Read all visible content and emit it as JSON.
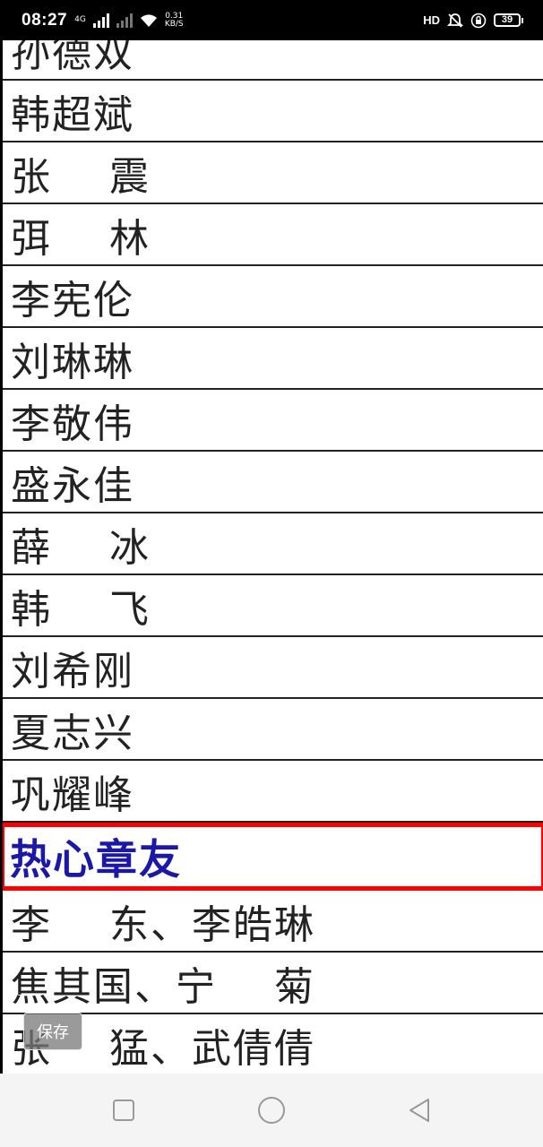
{
  "status_bar": {
    "time": "08:27",
    "network_type": "4G",
    "speed_value": "0.31",
    "speed_unit": "KB/S",
    "hd_label": "HD",
    "battery_level": "39"
  },
  "table": {
    "rows": [
      {
        "text": "孙德双",
        "type": "name"
      },
      {
        "text": "韩超斌",
        "type": "name"
      },
      {
        "text": "张    震",
        "type": "name"
      },
      {
        "text": "弭    林",
        "type": "name"
      },
      {
        "text": "李宪伦",
        "type": "name"
      },
      {
        "text": "刘琳琳",
        "type": "name"
      },
      {
        "text": "李敬伟",
        "type": "name"
      },
      {
        "text": "盛永佳",
        "type": "name"
      },
      {
        "text": "薛    冰",
        "type": "name"
      },
      {
        "text": "韩    飞",
        "type": "name"
      },
      {
        "text": "刘希刚",
        "type": "name"
      },
      {
        "text": "夏志兴",
        "type": "name"
      },
      {
        "text": "巩耀峰",
        "type": "name"
      },
      {
        "text": "热心章友",
        "type": "header"
      },
      {
        "text": "李    东、李皓琳",
        "type": "name"
      },
      {
        "text": "焦其国、宁    菊",
        "type": "name"
      },
      {
        "text": "张    猛、武倩倩",
        "type": "name"
      }
    ]
  },
  "overlay": {
    "save_label": "保存"
  },
  "colors": {
    "header_text": "#1b18a8",
    "header_border": "#ff0000",
    "status_bar_bg": "#000000",
    "nav_bar_bg": "#f4f4f4"
  },
  "icons": {
    "recent": "square-icon",
    "home": "circle-icon",
    "back": "triangle-back-icon"
  }
}
